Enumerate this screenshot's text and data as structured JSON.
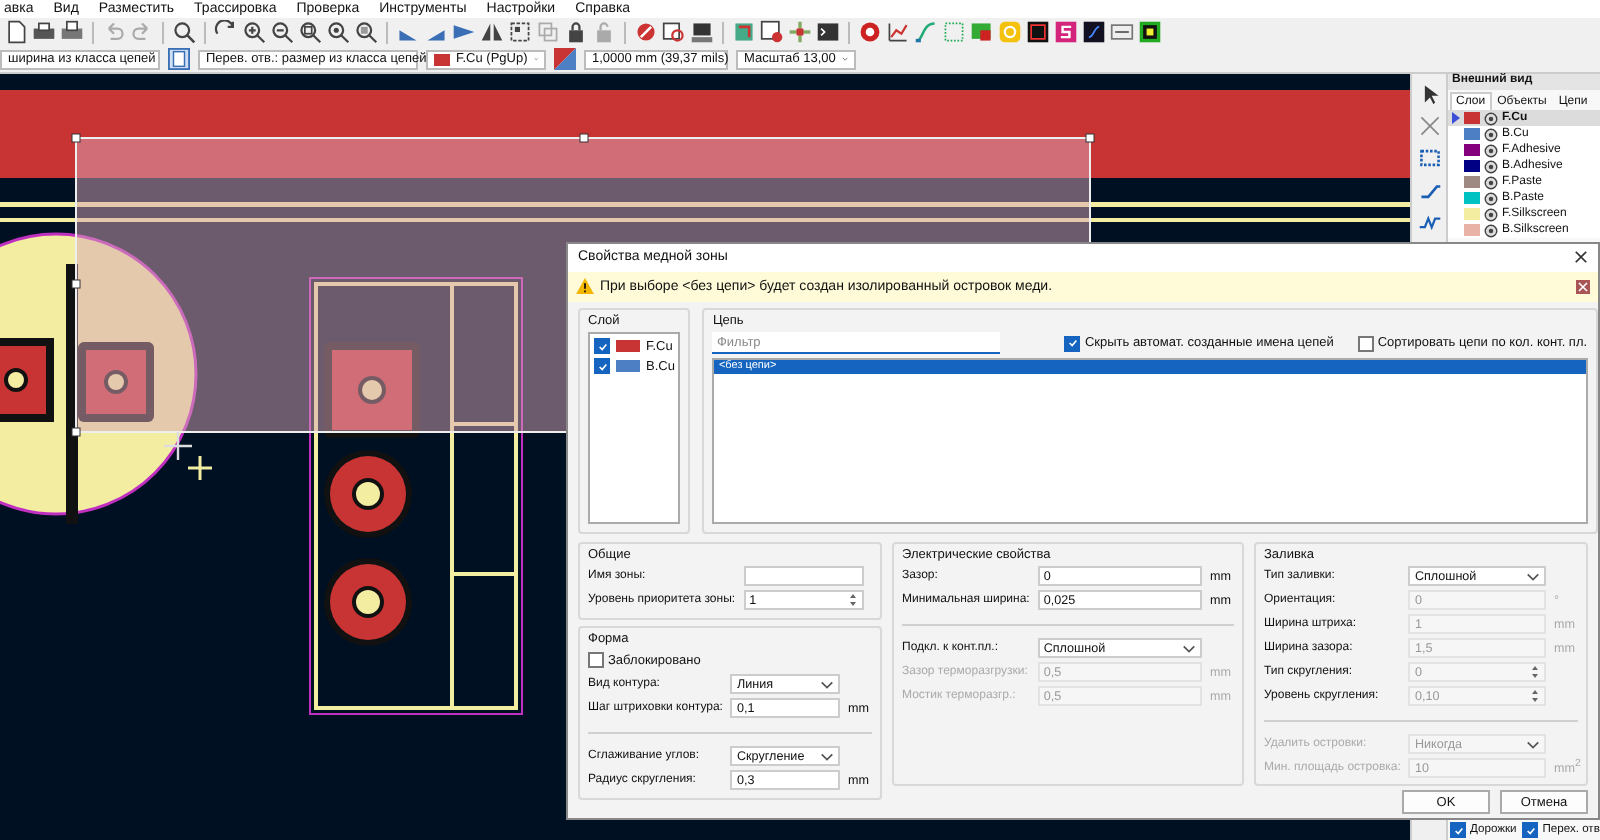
{
  "menu": [
    "авка",
    "Вид",
    "Разместить",
    "Трассировка",
    "Проверка",
    "Инструменты",
    "Настройки",
    "Справка"
  ],
  "toolbar": {
    "track_width": "ширина из класса цепей",
    "via_size": "Перев. отв.: размер из класса цепей",
    "layer": "F.Cu (PgUp)",
    "grid": "1,0000 mm (39,37 mils)",
    "zoom": "Масштаб 13,00"
  },
  "appearance": {
    "title": "Внешний вид",
    "tabs": [
      {
        "label": "Слои",
        "selected": true
      },
      {
        "label": "Объекты",
        "selected": false
      },
      {
        "label": "Цепи",
        "selected": false
      }
    ],
    "layers": [
      {
        "name": "F.Cu",
        "color": "#c83434",
        "selected": true
      },
      {
        "name": "B.Cu",
        "color": "#4d7fc4",
        "selected": false
      },
      {
        "name": "F.Adhesive",
        "color": "#84007c",
        "selected": false
      },
      {
        "name": "B.Adhesive",
        "color": "#000084",
        "selected": false
      },
      {
        "name": "F.Paste",
        "color": "#9e8a82",
        "selected": false
      },
      {
        "name": "B.Paste",
        "color": "#00c2c2",
        "selected": false
      },
      {
        "name": "F.Silkscreen",
        "color": "#f2eda1",
        "selected": false
      },
      {
        "name": "B.Silkscreen",
        "color": "#e8b2a7",
        "selected": false
      }
    ],
    "objects": [
      {
        "label": "Дорожки",
        "checked": true
      },
      {
        "label": "Перех. отв",
        "checked": true
      }
    ]
  },
  "dialog": {
    "title": "Свойства медной зоны",
    "warning": "При выборе <без цепи> будет создан изолированный островок меди.",
    "layer_group": {
      "title": "Слой",
      "layers": [
        {
          "name": "F.Cu",
          "color": "#c83434",
          "checked": true
        },
        {
          "name": "B.Cu",
          "color": "#4d7fc4",
          "checked": true
        }
      ]
    },
    "net_group": {
      "title": "Цепь",
      "filter_placeholder": "Фильтр",
      "hide_auto": {
        "label": "Скрыть автомат. созданные имена цепей",
        "checked": true
      },
      "sort_by_pads": {
        "label": "Сортировать цепи по кол. конт. пл.",
        "checked": false
      },
      "nets": [
        {
          "label": "<без цепи>",
          "selected": true
        }
      ]
    },
    "general": {
      "title": "Общие",
      "rows": [
        {
          "kind": "text",
          "label": "Имя зоны:",
          "disabled": false,
          "label_disabled": false
        },
        {
          "kind": "spin",
          "label": "Уровень приоритета зоны:",
          "value": "1",
          "disabled": false,
          "label_disabled": false
        }
      ]
    },
    "shape": {
      "title": "Форма",
      "rows": [
        {
          "kind": "check",
          "label": "Заблокировано",
          "checked": false
        },
        {
          "kind": "select",
          "label": "Вид контура:",
          "value": "Линия",
          "disabled": false,
          "label_disabled": false
        },
        {
          "kind": "text",
          "label": "Шаг штриховки контура:",
          "value": "0,1",
          "unit": "mm",
          "disabled": false,
          "label_disabled": false
        },
        {
          "kind": "separator"
        },
        {
          "kind": "select",
          "label": "Сглаживание углов:",
          "value": "Скругление",
          "disabled": false,
          "label_disabled": false
        },
        {
          "kind": "text",
          "label": "Радиус скругления:",
          "value": "0,3",
          "unit": "mm",
          "disabled": false,
          "label_disabled": false
        }
      ]
    },
    "electrical": {
      "title": "Электрические свойства",
      "rows": [
        {
          "kind": "text",
          "label": "Зазор:",
          "value": "0",
          "unit": "mm",
          "disabled": false,
          "label_disabled": false
        },
        {
          "kind": "text",
          "label": "Минимальная ширина:",
          "value": "0,025",
          "unit": "mm",
          "disabled": false,
          "label_disabled": false
        },
        {
          "kind": "separator"
        },
        {
          "kind": "select",
          "label": "Подкл. к конт.пл.:",
          "value": "Сплошной",
          "disabled": false,
          "label_disabled": false
        },
        {
          "kind": "text",
          "label": "Зазор терморазгрузки:",
          "value": "0,5",
          "unit": "mm",
          "disabled": true,
          "label_disabled": true
        },
        {
          "kind": "text",
          "label": "Мостик терморазгр.:",
          "value": "0,5",
          "unit": "mm",
          "disabled": true,
          "label_disabled": true
        }
      ]
    },
    "fill": {
      "title": "Заливка",
      "rows": [
        {
          "kind": "select",
          "label": "Тип заливки:",
          "value": "Сплошной",
          "disabled": false,
          "label_disabled": false
        },
        {
          "kind": "text",
          "label": "Ориентация:",
          "value": "0",
          "unit": "°",
          "disabled": true,
          "label_disabled": false
        },
        {
          "kind": "text",
          "label": "Ширина штриха:",
          "value": "1",
          "unit": "mm",
          "disabled": true,
          "label_disabled": false
        },
        {
          "kind": "text",
          "label": "Ширина зазора:",
          "value": "1,5",
          "unit": "mm",
          "disabled": true,
          "label_disabled": false
        },
        {
          "kind": "spin",
          "label": "Тип скругления:",
          "value": "0",
          "disabled": true,
          "label_disabled": false
        },
        {
          "kind": "spin",
          "label": "Уровень скругления:",
          "value": "0,10",
          "disabled": true,
          "label_disabled": false
        },
        {
          "kind": "separator"
        },
        {
          "kind": "select",
          "label": "Удалить островки:",
          "value": "Никогда",
          "disabled": true,
          "label_disabled": true
        },
        {
          "kind": "text",
          "label": "Мин. площадь островка:",
          "value": "10",
          "unit": "mm$^{2}$",
          "disabled": true,
          "label_disabled": true
        }
      ]
    },
    "buttons": [
      "OK",
      "Отмена"
    ]
  }
}
